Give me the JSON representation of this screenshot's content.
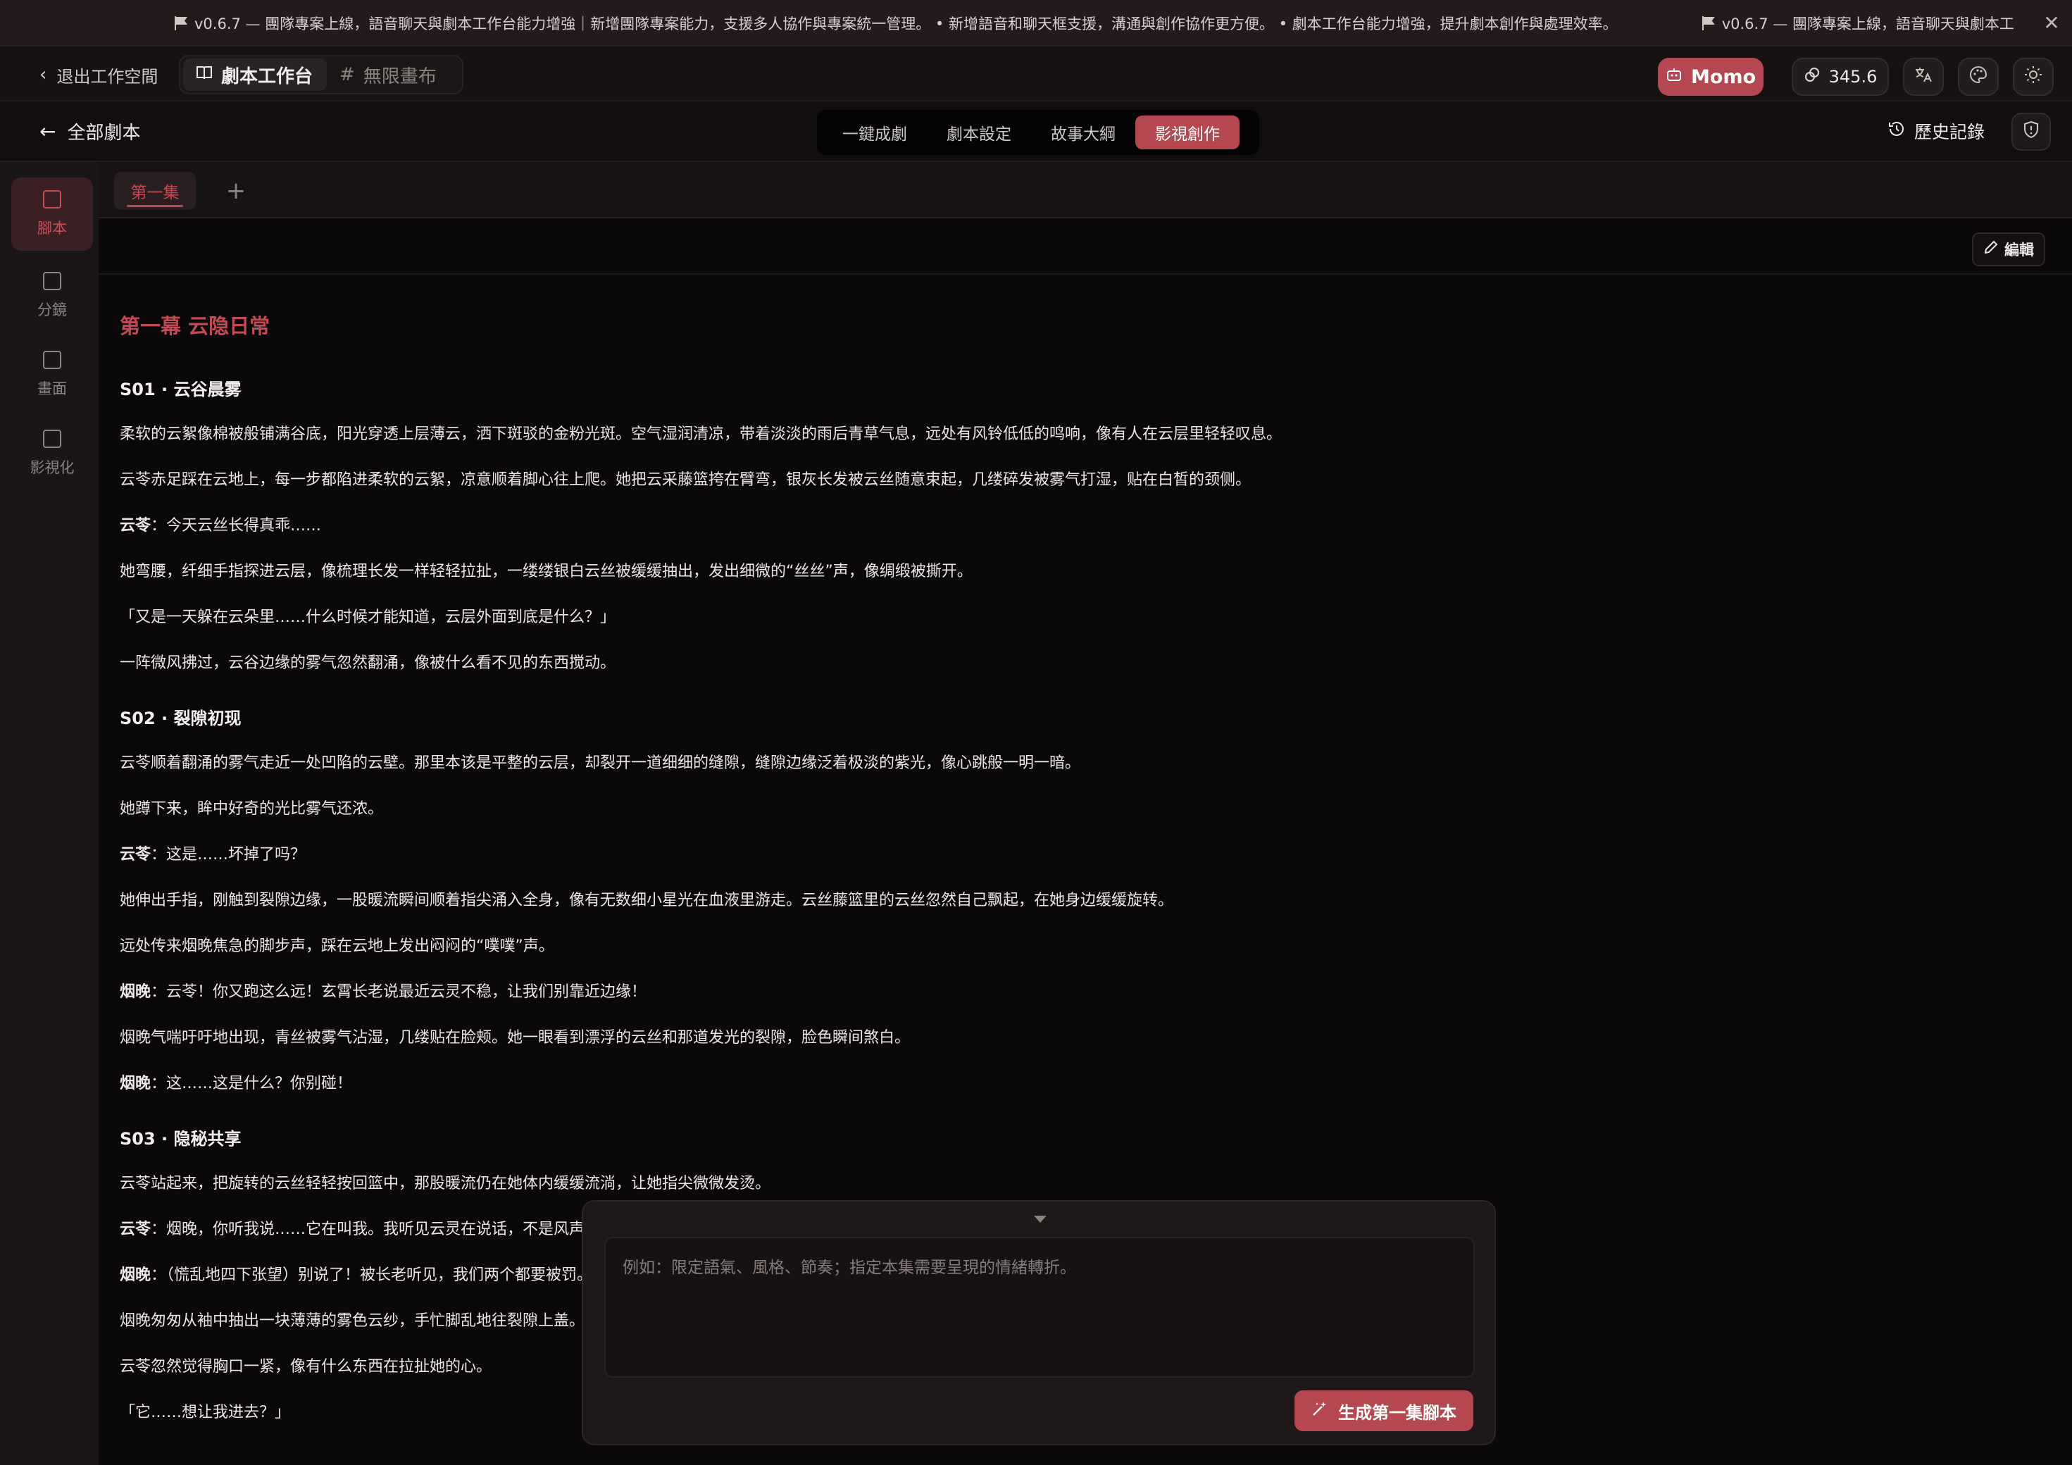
{
  "announcement": {
    "items": [
      "v0.6.7 — 團隊專案上線，語音聊天與劇本工作台能力增強｜新增團隊專案能力，支援多人協作與專案統一管理。 • 新增語音和聊天框支援，溝通與創作協作更方便。 • 劇本工作台能力增強，提升劇本創作與處理效率。",
      "v0.6.7 — 團隊專案上線，語音聊天與劇本工"
    ],
    "close_icon": "✕"
  },
  "topnav": {
    "exit_label": "退出工作空間",
    "workspace_tabs": [
      {
        "label": "劇本工作台",
        "icon": "book-icon",
        "glyph": "▯"
      },
      {
        "label": "無限畫布",
        "icon": "hash-icon",
        "glyph": "#"
      }
    ],
    "momo_label": "Momo",
    "credits": "345.6",
    "colors": {
      "accent": "#b54750"
    }
  },
  "subnav": {
    "back_label": "全部劇本",
    "steps": [
      "一鍵成劇",
      "劇本設定",
      "故事大綱",
      "影視創作"
    ],
    "active_step": 3,
    "history_label": "歷史記錄"
  },
  "rail": {
    "items": [
      {
        "label": "腳本",
        "icon": "script-icon"
      },
      {
        "label": "分鏡",
        "icon": "storyboard-icon"
      },
      {
        "label": "畫面",
        "icon": "frame-icon"
      },
      {
        "label": "影視化",
        "icon": "clapper-icon"
      }
    ],
    "active": 0
  },
  "episodes": {
    "tabs": [
      "第一集"
    ],
    "add_label": "+"
  },
  "editor": {
    "edit_label": "編輯"
  },
  "script": {
    "act_title": "第一幕 云隐日常",
    "scenes": [
      {
        "title": "S01 · 云谷晨雾",
        "paras": [
          {
            "text": "柔软的云絮像棉被般铺满谷底，阳光穿透上层薄云，洒下斑驳的金粉光斑。空气湿润清凉，带着淡淡的雨后青草气息，远处有风铃低低的鸣响，像有人在云层里轻轻叹息。"
          },
          {
            "text": "云苓赤足踩在云地上，每一步都陷进柔软的云絮，凉意顺着脚心往上爬。她把云采藤篮挎在臂弯，银灰长发被云丝随意束起，几缕碎发被雾气打湿，贴在白皙的颈侧。"
          },
          {
            "speaker": "云苓",
            "text": "：今天云丝长得真乖……"
          },
          {
            "text": "她弯腰，纤细手指探进云层，像梳理长发一样轻轻拉扯，一缕缕银白云丝被缓缓抽出，发出细微的“丝丝”声，像绸缎被撕开。"
          },
          {
            "text": "「又是一天躲在云朵里……什么时候才能知道，云层外面到底是什么？」"
          },
          {
            "text": "一阵微风拂过，云谷边缘的雾气忽然翻涌，像被什么看不见的东西搅动。"
          }
        ]
      },
      {
        "title": "S02 · 裂隙初现",
        "paras": [
          {
            "text": "云苓顺着翻涌的雾气走近一处凹陷的云壁。那里本该是平整的云层，却裂开一道细细的缝隙，缝隙边缘泛着极淡的紫光，像心跳般一明一暗。"
          },
          {
            "text": "她蹲下来，眸中好奇的光比雾气还浓。"
          },
          {
            "speaker": "云苓",
            "text": "：这是……坏掉了吗？"
          },
          {
            "text": "她伸出手指，刚触到裂隙边缘，一股暖流瞬间顺着指尖涌入全身，像有无数细小星光在血液里游走。云丝藤篮里的云丝忽然自己飘起，在她身边缓缓旋转。"
          },
          {
            "text": "远处传来烟晚焦急的脚步声，踩在云地上发出闷闷的“噗噗”声。"
          },
          {
            "speaker": "烟晚",
            "text": "：云苓！你又跑这么远！玄霄长老说最近云灵不稳，让我们别靠近边缘！"
          },
          {
            "text": "烟晚气喘吁吁地出现，青丝被雾气沾湿，几缕贴在脸颊。她一眼看到漂浮的云丝和那道发光的裂隙，脸色瞬间煞白。"
          },
          {
            "speaker": "烟晚",
            "text": "：这……这是什么？你别碰！"
          }
        ]
      },
      {
        "title": "S03 · 隐秘共享",
        "paras": [
          {
            "text": "云苓站起来，把旋转的云丝轻轻按回篮中，那股暖流仍在她体内缓缓流淌，让她指尖微微发烫。"
          },
          {
            "speaker": "云苓",
            "text": "：烟晚，你听我说……它在叫我。我听见云灵在说话，不是风声。"
          },
          {
            "speaker": "烟晚",
            "text": "：（慌乱地四下张望）别说了！被长老听见，我们两个都要被罚。"
          },
          {
            "text": "烟晚匆匆从袖中抽出一块薄薄的雾色云纱，手忙脚乱地往裂隙上盖。"
          },
          {
            "text": "云苓忽然觉得胸口一紧，像有什么东西在拉扯她的心。"
          },
          {
            "text": "「它……想让我进去？」"
          }
        ]
      }
    ]
  },
  "prompt": {
    "placeholder": "例如：限定語氣、風格、節奏；指定本集需要呈現的情緒轉折。",
    "generate_label": "生成第一集腳本"
  }
}
